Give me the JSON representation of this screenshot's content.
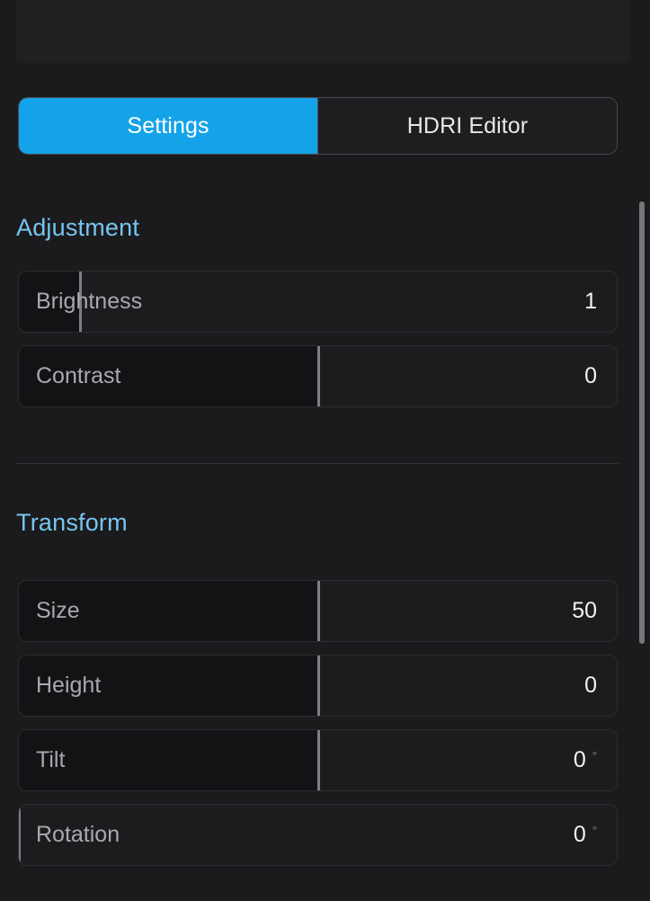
{
  "theme": {
    "background": "#1b1b1d",
    "accent": "#14a3e8",
    "section_heading": "#76c5f0",
    "row_track": "#1c1c1e",
    "row_fill": "#131315",
    "handle": "#7e7e86",
    "label_text": "#a9a9ae",
    "value_text": "#f2f2f4",
    "scrollbar": "#76767c"
  },
  "tabs": [
    {
      "label": "Settings",
      "active": true
    },
    {
      "label": "HDRI Editor",
      "active": false
    }
  ],
  "sections": [
    {
      "title": "Adjustment",
      "rows": [
        {
          "label": "Brightness",
          "value": "1",
          "unit": "",
          "fill_percent": 10.2
        },
        {
          "label": "Contrast",
          "value": "0",
          "unit": "",
          "fill_percent": 50.0
        }
      ]
    },
    {
      "title": "Transform",
      "rows": [
        {
          "label": "Size",
          "value": "50",
          "unit": "",
          "fill_percent": 50.0
        },
        {
          "label": "Height",
          "value": "0",
          "unit": "",
          "fill_percent": 50.0
        },
        {
          "label": "Tilt",
          "value": "0",
          "unit": "°",
          "fill_percent": 50.0
        },
        {
          "label": "Rotation",
          "value": "0",
          "unit": "°",
          "fill_percent": 0.0
        }
      ]
    }
  ],
  "scrollbar": {
    "thumb_top_percent": 4.5,
    "thumb_height_percent": 92.8
  }
}
